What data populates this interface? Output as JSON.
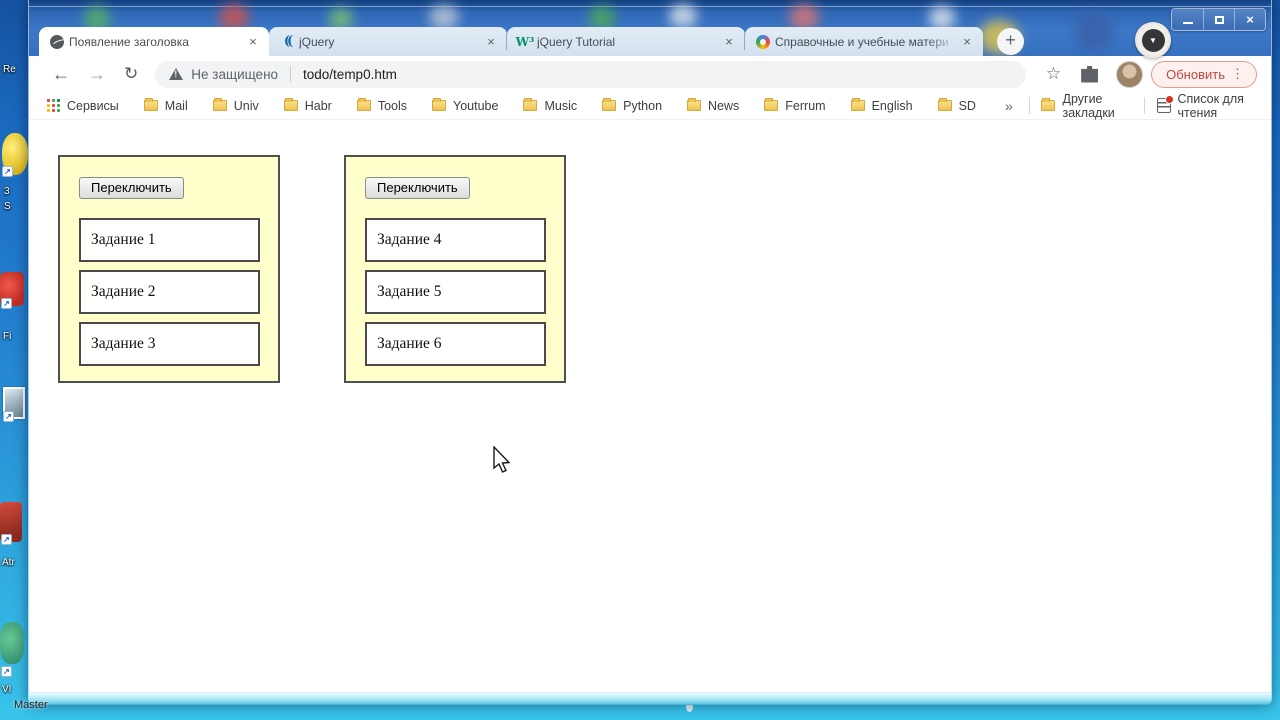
{
  "colors": {
    "glass_blue": "#3d78c8",
    "active_tab_bg": "#ffffff",
    "inactive_tab_bg": "#dce7f2",
    "panel_bg": "#ffffcc",
    "panel_border": "#4f4f4f",
    "update_accent": "#c5473e",
    "jquery_blue": "#1266a9",
    "w3_green": "#059466"
  },
  "desktop": {
    "labels": {
      "re": "Re",
      "row1a": "3",
      "row1b": "S",
      "fi": "Fi",
      "atr": "Atr",
      "vi": "VI",
      "master": "Master"
    },
    "shortcut_arrow": "↗"
  },
  "titlebar": {
    "close_glyph": "×",
    "record_chevron": "▼"
  },
  "tabs": [
    {
      "title": "Появление заголовка",
      "favicon": "globe-icon",
      "active": true
    },
    {
      "title": "jQuery",
      "favicon": "jquery-icon",
      "active": false
    },
    {
      "title": "jQuery Tutorial",
      "favicon": "w3schools-icon",
      "active": false
    },
    {
      "title": "Справочные и учебные матери",
      "favicon": "pinwheel-icon",
      "active": false
    }
  ],
  "tabstrip": {
    "close_glyph": "×",
    "new_tab_glyph": "+",
    "jquery_glyph": "((",
    "w3_glyph": "W³"
  },
  "toolbar": {
    "back_glyph": "←",
    "forward_glyph": "→",
    "reload_glyph": "↻",
    "security_label": "Не защищено",
    "url": "todo/temp0.htm",
    "star_glyph": "☆",
    "update_label": "Обновить",
    "menu_dots": "⋮"
  },
  "bookmarks": {
    "apps_label": "Сервисы",
    "items": [
      "Mail",
      "Univ",
      "Habr",
      "Tools",
      "Youtube",
      "Music",
      "Python",
      "News",
      "Ferrum",
      "English",
      "SD"
    ],
    "overflow_glyph": "»",
    "other_label": "Другие закладки",
    "reading_list_label": "Список для чтения"
  },
  "page": {
    "panels": [
      {
        "button_label": "Переключить",
        "tasks": [
          "Задание 1",
          "Задание 2",
          "Задание 3"
        ]
      },
      {
        "button_label": "Переключить",
        "tasks": [
          "Задание 4",
          "Задание 5",
          "Задание 6"
        ]
      }
    ]
  }
}
